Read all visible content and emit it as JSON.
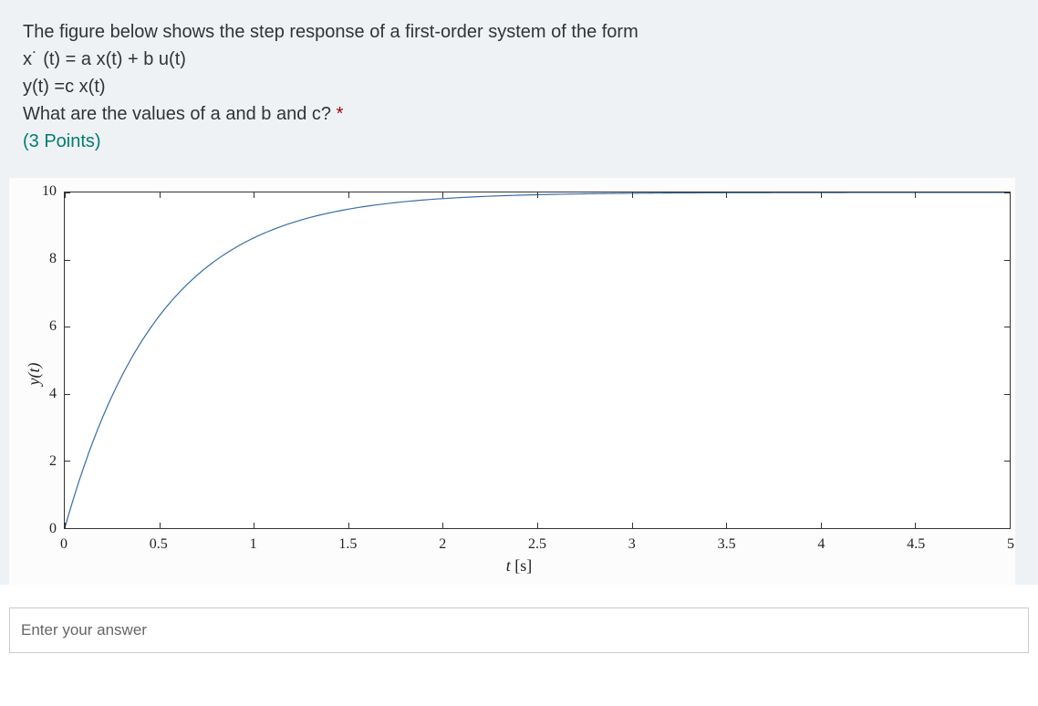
{
  "question": {
    "line1": "The figure below shows the step response of a first-order system of the form",
    "line2": "x˙ (t) = a x(t) + b u(t)",
    "line3": "y(t) =c x(t)",
    "line4": "What are the values of a and b and c?",
    "required_mark": "*",
    "points": "(3 Points)"
  },
  "chart_data": {
    "type": "line",
    "xlabel_var": "t",
    "xlabel_unit": "[s]",
    "ylabel": "y(t)",
    "xlim": [
      0,
      5
    ],
    "ylim": [
      0,
      10
    ],
    "xticks": [
      0,
      0.5,
      1,
      1.5,
      2,
      2.5,
      3,
      3.5,
      4,
      4.5,
      5
    ],
    "yticks": [
      0,
      2,
      4,
      6,
      8,
      10
    ],
    "curve": {
      "description": "First-order step response y(t) = 10*(1 - exp(-2*t)), steady-state 10, time constant 0.5s",
      "steady_state": 10,
      "time_constant": 0.5,
      "initial_value": 0
    }
  },
  "answer": {
    "placeholder": "Enter your answer",
    "value": ""
  }
}
